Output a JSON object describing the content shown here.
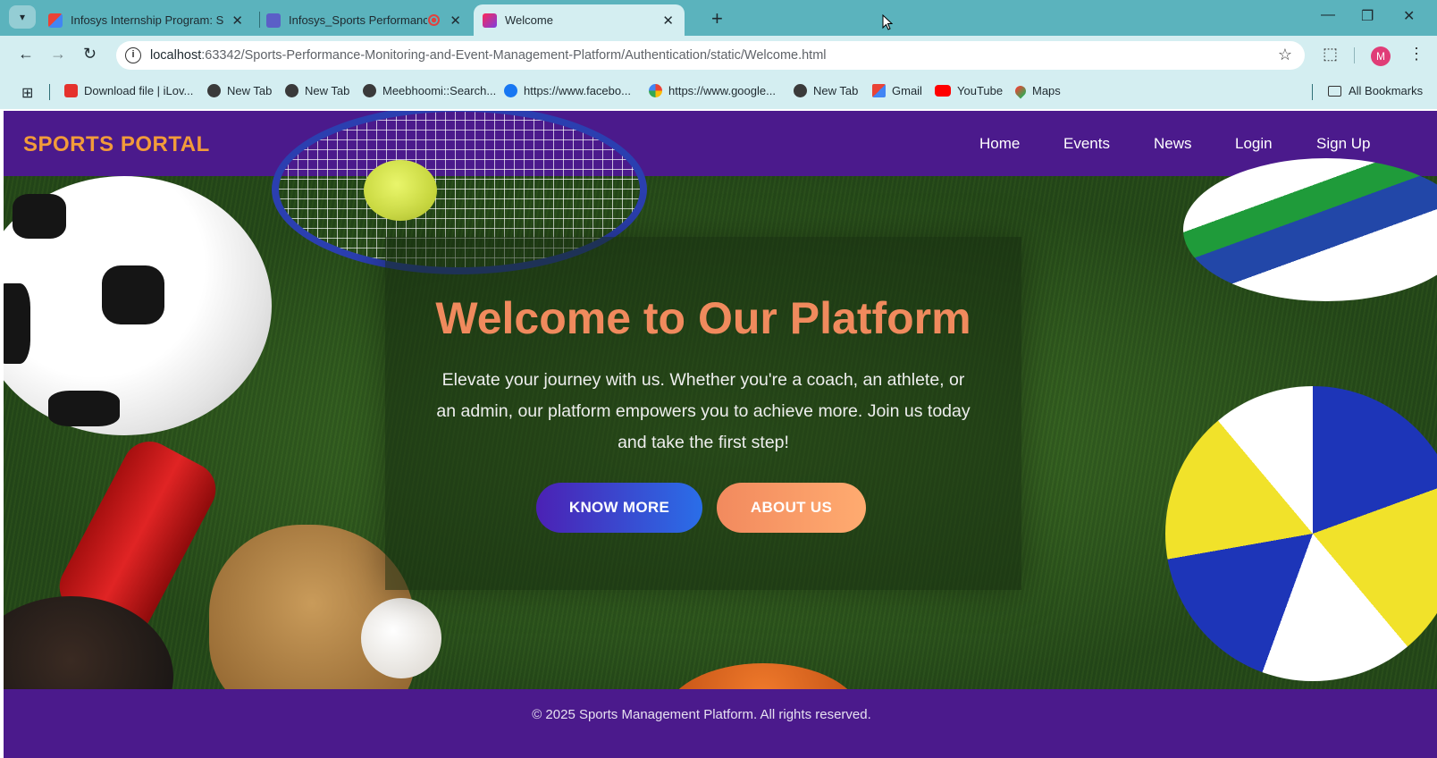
{
  "browser": {
    "tabs": [
      {
        "title": "Infosys Internship Program: Sp",
        "active": false
      },
      {
        "title": "Infosys_Sports Performance",
        "active": false
      },
      {
        "title": "Welcome",
        "active": true
      }
    ],
    "url_host": "localhost",
    "url_path": ":63342/Sports-Performance-Monitoring-and-Event-Management-Platform/Authentication/static/Welcome.html",
    "profile_initial": "M",
    "bookmarks": [
      "Download file | iLov...",
      "New Tab",
      "New Tab",
      "Meebhoomi::Search...",
      "https://www.facebo...",
      "https://www.google...",
      "New Tab",
      "Gmail",
      "YouTube",
      "Maps"
    ],
    "all_bookmarks": "All Bookmarks"
  },
  "site": {
    "brand": "SPORTS PORTAL",
    "nav": [
      "Home",
      "Events",
      "News",
      "Login",
      "Sign Up"
    ],
    "hero": {
      "title": "Welcome to Our Platform",
      "text": "Elevate your journey with us. Whether you're a coach, an athlete, or an admin, our platform empowers you to achieve more. Join us today and take the first step!",
      "buttons": [
        "KNOW MORE",
        "ABOUT US"
      ]
    },
    "footer": "© 2025 Sports Management Platform. All rights reserved."
  },
  "colors": {
    "tab_bar": "#5bb3bd",
    "toolbar": "#d4eef1",
    "navbar": "#4b1a8c",
    "brand": "#f29b3a",
    "hero_title": "#f08a5d"
  }
}
